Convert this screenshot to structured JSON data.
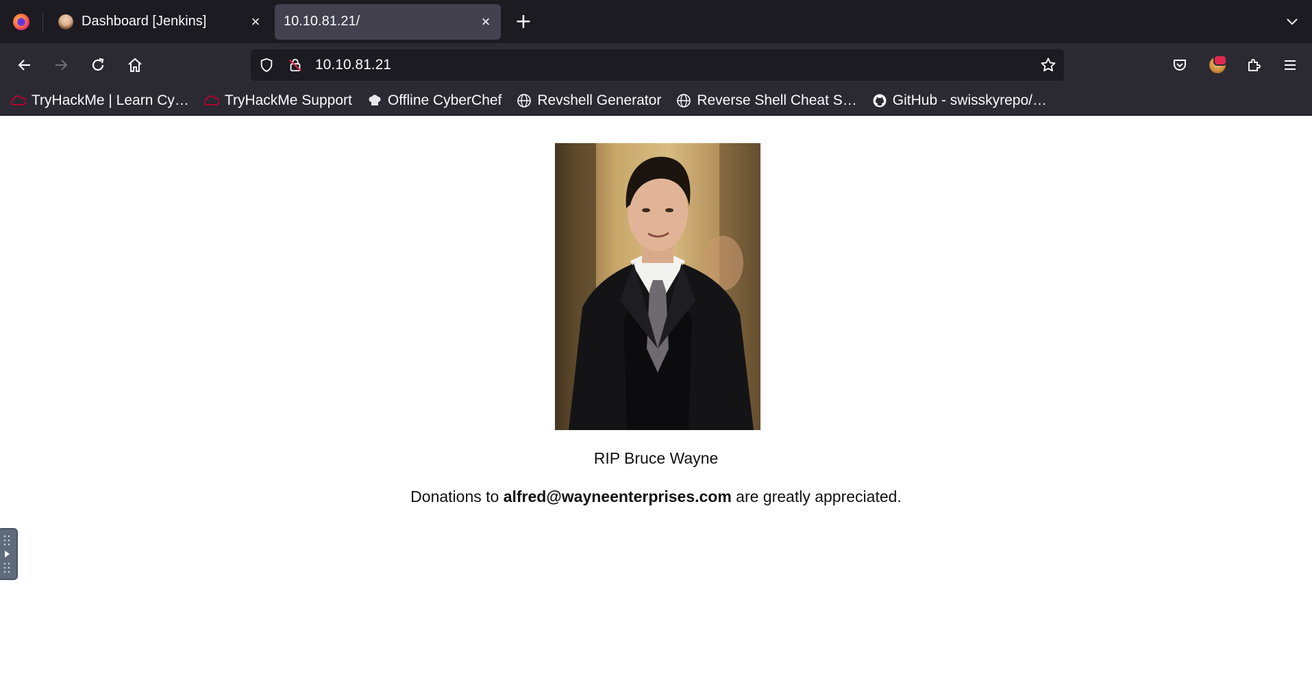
{
  "browser": {
    "tabs": [
      {
        "title": "Dashboard [Jenkins]",
        "favicon": "jenkins-icon",
        "active": false
      },
      {
        "title": "10.10.81.21/",
        "favicon": null,
        "active": true
      }
    ],
    "close_glyph": "×",
    "new_tab_glyph": "+",
    "url": "10.10.81.21",
    "colors": {
      "tabstrip": "#1c1b22",
      "toolbar": "#2b2a33",
      "active_tab": "#42414d",
      "urlbar": "#1c1b22",
      "text": "#fbfbfe"
    }
  },
  "bookmarks": [
    {
      "label": "TryHackMe | Learn Cy…",
      "icon": "tryhackme-icon"
    },
    {
      "label": "TryHackMe Support",
      "icon": "tryhackme-icon"
    },
    {
      "label": "Offline CyberChef",
      "icon": "chef-hat-icon"
    },
    {
      "label": "Revshell Generator",
      "icon": "globe-icon"
    },
    {
      "label": "Reverse Shell Cheat S…",
      "icon": "globe-icon"
    },
    {
      "label": "GitHub - swisskyrepo/…",
      "icon": "github-icon"
    }
  ],
  "page": {
    "caption": "RIP Bruce Wayne",
    "donation_prefix": "Donations to ",
    "donation_email": "alfred@wayneenterprises.com",
    "donation_suffix": " are greatly appreciated."
  }
}
